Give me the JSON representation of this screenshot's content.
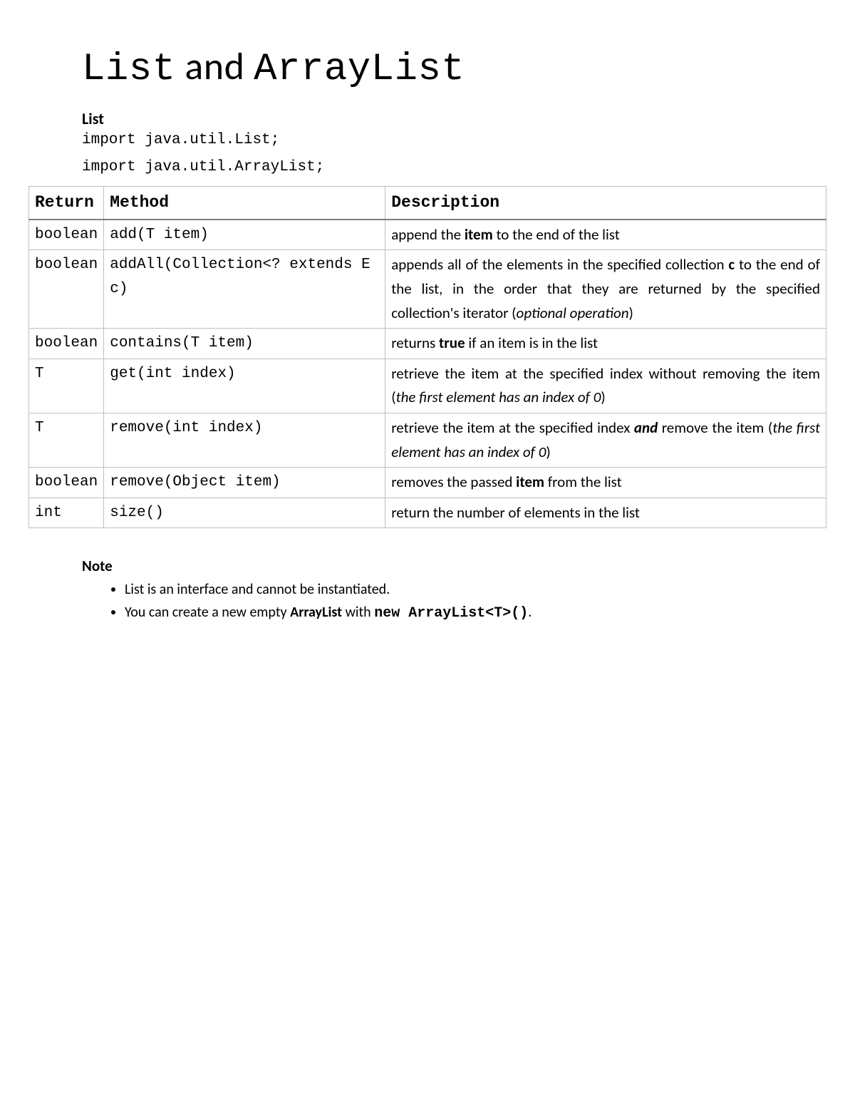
{
  "title": {
    "mono1": "List",
    "sep": " and ",
    "mono2": "ArrayList"
  },
  "section_heading": "List",
  "imports": [
    "import java.util.List;",
    "import java.util.ArrayList;"
  ],
  "table": {
    "headers": {
      "return": "Return",
      "method": "Method",
      "description": "Description"
    },
    "rows": [
      {
        "return": "boolean",
        "method": "add(T item)",
        "desc": [
          {
            "t": "append the "
          },
          {
            "t": "item",
            "cls": "bold"
          },
          {
            "t": " to the end of the list"
          }
        ]
      },
      {
        "return": "boolean",
        "method": "addAll(Collection<? extends E c)",
        "desc": [
          {
            "t": "appends all of the elements in the specified collection "
          },
          {
            "t": "c",
            "cls": "bold"
          },
          {
            "t": " to the end of the list, in the order that they are returned by the specified collection's iterator ("
          },
          {
            "t": "optional operation",
            "cls": "italic"
          },
          {
            "t": ")"
          }
        ]
      },
      {
        "return": "boolean",
        "method": "contains(T item)",
        "desc": [
          {
            "t": "returns "
          },
          {
            "t": "true",
            "cls": "bold"
          },
          {
            "t": " if an item is in the list"
          }
        ]
      },
      {
        "return": "T",
        "method": "get(int index)",
        "desc": [
          {
            "t": "retrieve the item at the specified index without removing the item ("
          },
          {
            "t": "the first element has an index of 0",
            "cls": "italic"
          },
          {
            "t": ")"
          }
        ]
      },
      {
        "return": "T",
        "method": "remove(int index)",
        "desc": [
          {
            "t": "retrieve the item at the specified index "
          },
          {
            "t": "and",
            "cls": "bold-italic"
          },
          {
            "t": " remove the item ("
          },
          {
            "t": "the first element has an index of 0",
            "cls": "italic"
          },
          {
            "t": ")"
          }
        ]
      },
      {
        "return": "boolean",
        "method": "remove(Object item)",
        "desc": [
          {
            "t": "removes the passed "
          },
          {
            "t": "item",
            "cls": "bold"
          },
          {
            "t": " from the list"
          }
        ]
      },
      {
        "return": "int",
        "method": "size()",
        "desc": [
          {
            "t": "return the number of elements in the list"
          }
        ]
      }
    ]
  },
  "note": {
    "heading": "Note",
    "items": [
      [
        {
          "t": "List is an interface and cannot be instantiated."
        }
      ],
      [
        {
          "t": "You can create a new empty "
        },
        {
          "t": "ArrayList",
          "cls": "bold"
        },
        {
          "t": " with "
        },
        {
          "t": "new ArrayList<T>()",
          "cls": "bold mono"
        },
        {
          "t": "."
        }
      ]
    ]
  }
}
